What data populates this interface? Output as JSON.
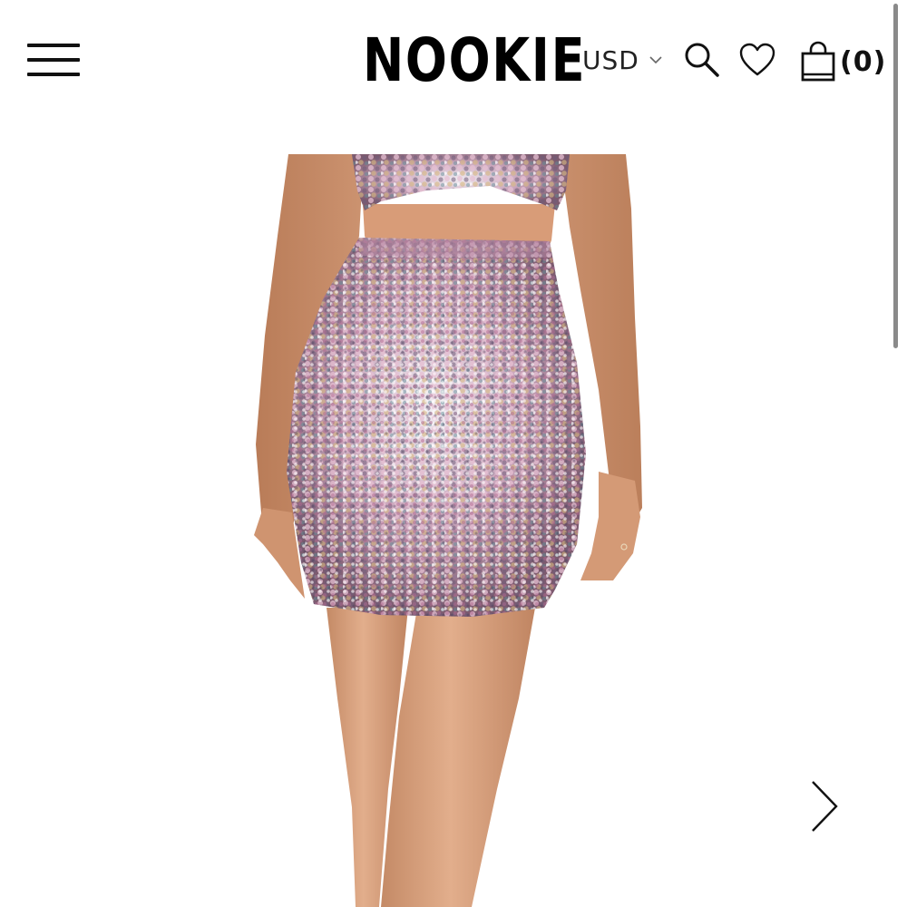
{
  "header": {
    "brand": "NOOKIE",
    "currency": "USD",
    "cart_count": "(0)"
  },
  "icons": {
    "menu": "hamburger-menu-icon",
    "currency_toggle": "chevron-down-icon",
    "search": "search-icon",
    "wishlist": "heart-icon",
    "cart": "shopping-bag-icon",
    "next": "chevron-right-icon"
  },
  "colors": {
    "text": "#111111",
    "background": "#ffffff",
    "skin": "#d9a07c",
    "sequin_pink": "#d98fb0",
    "sequin_silver": "#e8e6ee",
    "sequin_gold": "#d7b77a",
    "sequin_teal": "#4f8c98"
  }
}
